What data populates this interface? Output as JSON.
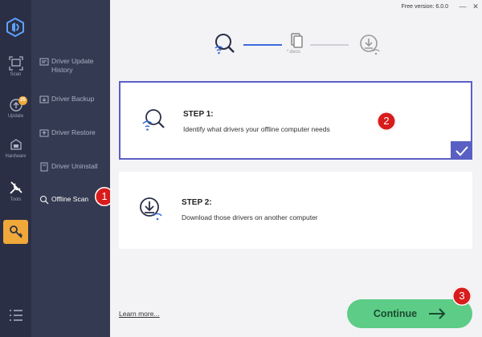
{
  "window": {
    "version": "Free version: 6.0.0",
    "minimize_glyph": "—",
    "close_glyph": "✕"
  },
  "rail": {
    "items": [
      {
        "icon": "scan-icon",
        "label": "Scan"
      },
      {
        "icon": "update-icon",
        "label": "Update",
        "badge": "25"
      },
      {
        "icon": "hardware-icon",
        "label": "Hardware"
      },
      {
        "icon": "tools-icon",
        "label": "Tools"
      },
      {
        "icon": "key-icon",
        "label": ""
      }
    ],
    "menu_icon": "menu-icon"
  },
  "subnav": {
    "items": [
      {
        "label": "Driver Update History"
      },
      {
        "label": "Driver Backup"
      },
      {
        "label": "Driver Restore"
      },
      {
        "label": "Driver Uninstall"
      },
      {
        "label": "Offline Scan"
      }
    ]
  },
  "track": {
    "middle_caption": "*.deos"
  },
  "step1": {
    "title": "STEP 1:",
    "desc": "Identify what drivers your offline computer needs"
  },
  "step2": {
    "title": "STEP 2:",
    "desc": "Download those drivers on another computer"
  },
  "markers": {
    "m1": "1",
    "m2": "2",
    "m3": "3"
  },
  "footer": {
    "learn_more": "Learn more...",
    "continue_label": "Continue"
  },
  "colors": {
    "rail_bg": "#2a2f45",
    "subnav_bg": "#343a52",
    "accent": "#5a5fc4",
    "continue": "#5ccc86",
    "active_tool": "#f0a83a",
    "marker": "#d81c1c"
  }
}
